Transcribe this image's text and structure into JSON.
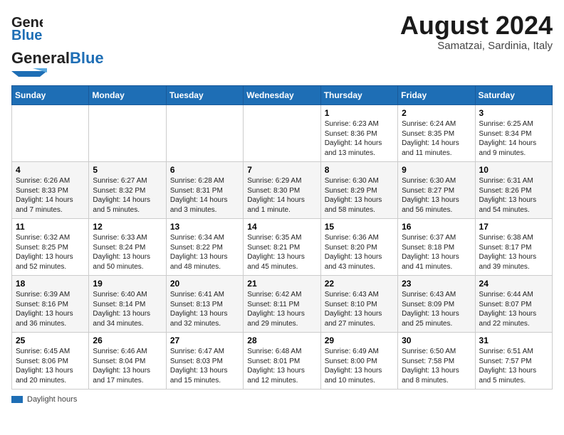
{
  "header": {
    "logo_general": "General",
    "logo_blue": "Blue",
    "month": "August 2024",
    "location": "Samatzai, Sardinia, Italy"
  },
  "days_of_week": [
    "Sunday",
    "Monday",
    "Tuesday",
    "Wednesday",
    "Thursday",
    "Friday",
    "Saturday"
  ],
  "weeks": [
    [
      {
        "day": "",
        "text": ""
      },
      {
        "day": "",
        "text": ""
      },
      {
        "day": "",
        "text": ""
      },
      {
        "day": "",
        "text": ""
      },
      {
        "day": "1",
        "text": "Sunrise: 6:23 AM\nSunset: 8:36 PM\nDaylight: 14 hours\nand 13 minutes."
      },
      {
        "day": "2",
        "text": "Sunrise: 6:24 AM\nSunset: 8:35 PM\nDaylight: 14 hours\nand 11 minutes."
      },
      {
        "day": "3",
        "text": "Sunrise: 6:25 AM\nSunset: 8:34 PM\nDaylight: 14 hours\nand 9 minutes."
      }
    ],
    [
      {
        "day": "4",
        "text": "Sunrise: 6:26 AM\nSunset: 8:33 PM\nDaylight: 14 hours\nand 7 minutes."
      },
      {
        "day": "5",
        "text": "Sunrise: 6:27 AM\nSunset: 8:32 PM\nDaylight: 14 hours\nand 5 minutes."
      },
      {
        "day": "6",
        "text": "Sunrise: 6:28 AM\nSunset: 8:31 PM\nDaylight: 14 hours\nand 3 minutes."
      },
      {
        "day": "7",
        "text": "Sunrise: 6:29 AM\nSunset: 8:30 PM\nDaylight: 14 hours\nand 1 minute."
      },
      {
        "day": "8",
        "text": "Sunrise: 6:30 AM\nSunset: 8:29 PM\nDaylight: 13 hours\nand 58 minutes."
      },
      {
        "day": "9",
        "text": "Sunrise: 6:30 AM\nSunset: 8:27 PM\nDaylight: 13 hours\nand 56 minutes."
      },
      {
        "day": "10",
        "text": "Sunrise: 6:31 AM\nSunset: 8:26 PM\nDaylight: 13 hours\nand 54 minutes."
      }
    ],
    [
      {
        "day": "11",
        "text": "Sunrise: 6:32 AM\nSunset: 8:25 PM\nDaylight: 13 hours\nand 52 minutes."
      },
      {
        "day": "12",
        "text": "Sunrise: 6:33 AM\nSunset: 8:24 PM\nDaylight: 13 hours\nand 50 minutes."
      },
      {
        "day": "13",
        "text": "Sunrise: 6:34 AM\nSunset: 8:22 PM\nDaylight: 13 hours\nand 48 minutes."
      },
      {
        "day": "14",
        "text": "Sunrise: 6:35 AM\nSunset: 8:21 PM\nDaylight: 13 hours\nand 45 minutes."
      },
      {
        "day": "15",
        "text": "Sunrise: 6:36 AM\nSunset: 8:20 PM\nDaylight: 13 hours\nand 43 minutes."
      },
      {
        "day": "16",
        "text": "Sunrise: 6:37 AM\nSunset: 8:18 PM\nDaylight: 13 hours\nand 41 minutes."
      },
      {
        "day": "17",
        "text": "Sunrise: 6:38 AM\nSunset: 8:17 PM\nDaylight: 13 hours\nand 39 minutes."
      }
    ],
    [
      {
        "day": "18",
        "text": "Sunrise: 6:39 AM\nSunset: 8:16 PM\nDaylight: 13 hours\nand 36 minutes."
      },
      {
        "day": "19",
        "text": "Sunrise: 6:40 AM\nSunset: 8:14 PM\nDaylight: 13 hours\nand 34 minutes."
      },
      {
        "day": "20",
        "text": "Sunrise: 6:41 AM\nSunset: 8:13 PM\nDaylight: 13 hours\nand 32 minutes."
      },
      {
        "day": "21",
        "text": "Sunrise: 6:42 AM\nSunset: 8:11 PM\nDaylight: 13 hours\nand 29 minutes."
      },
      {
        "day": "22",
        "text": "Sunrise: 6:43 AM\nSunset: 8:10 PM\nDaylight: 13 hours\nand 27 minutes."
      },
      {
        "day": "23",
        "text": "Sunrise: 6:43 AM\nSunset: 8:09 PM\nDaylight: 13 hours\nand 25 minutes."
      },
      {
        "day": "24",
        "text": "Sunrise: 6:44 AM\nSunset: 8:07 PM\nDaylight: 13 hours\nand 22 minutes."
      }
    ],
    [
      {
        "day": "25",
        "text": "Sunrise: 6:45 AM\nSunset: 8:06 PM\nDaylight: 13 hours\nand 20 minutes."
      },
      {
        "day": "26",
        "text": "Sunrise: 6:46 AM\nSunset: 8:04 PM\nDaylight: 13 hours\nand 17 minutes."
      },
      {
        "day": "27",
        "text": "Sunrise: 6:47 AM\nSunset: 8:03 PM\nDaylight: 13 hours\nand 15 minutes."
      },
      {
        "day": "28",
        "text": "Sunrise: 6:48 AM\nSunset: 8:01 PM\nDaylight: 13 hours\nand 12 minutes."
      },
      {
        "day": "29",
        "text": "Sunrise: 6:49 AM\nSunset: 8:00 PM\nDaylight: 13 hours\nand 10 minutes."
      },
      {
        "day": "30",
        "text": "Sunrise: 6:50 AM\nSunset: 7:58 PM\nDaylight: 13 hours\nand 8 minutes."
      },
      {
        "day": "31",
        "text": "Sunrise: 6:51 AM\nSunset: 7:57 PM\nDaylight: 13 hours\nand 5 minutes."
      }
    ]
  ],
  "legend": {
    "label": "Daylight hours"
  }
}
